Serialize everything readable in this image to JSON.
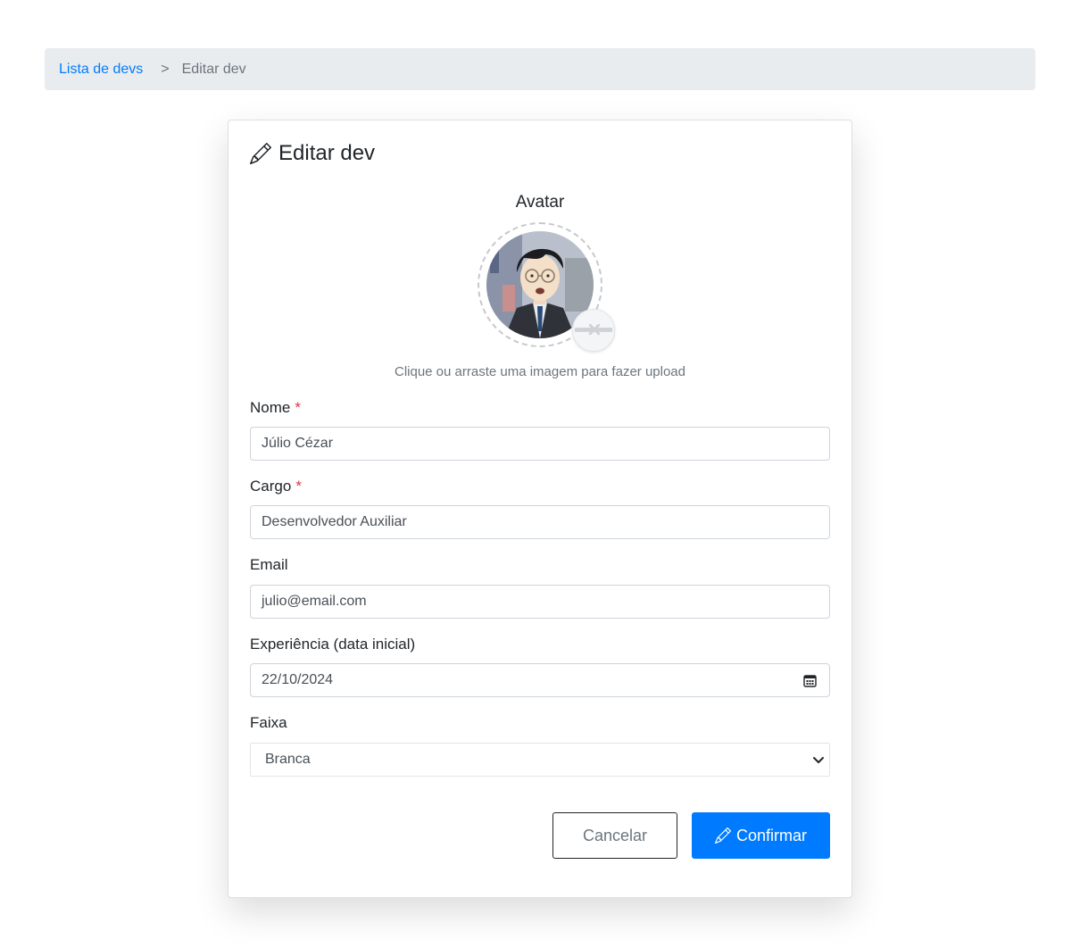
{
  "breadcrumb": {
    "parent": "Lista de devs",
    "separator": ">",
    "current": "Editar dev"
  },
  "card": {
    "title": "Editar dev",
    "title_icon": "pencil-icon"
  },
  "avatar": {
    "label": "Avatar",
    "hint": "Clique ou arraste uma imagem para fazer upload",
    "remove_icon": "remove-image-icon"
  },
  "form": {
    "name": {
      "label": "Nome",
      "required_mark": "*",
      "value": "Júlio Cézar"
    },
    "role": {
      "label": "Cargo",
      "required_mark": "*",
      "value": "Desenvolvedor Auxiliar"
    },
    "email": {
      "label": "Email",
      "value": "julio@email.com"
    },
    "experience": {
      "label": "Experiência (data inicial)",
      "value": "22/10/2024",
      "icon": "calendar-icon"
    },
    "belt": {
      "label": "Faixa",
      "selected": "Branca"
    }
  },
  "actions": {
    "cancel_label": "Cancelar",
    "confirm_label": "Confirmar"
  },
  "colors": {
    "primary": "#007bff",
    "required": "#dc3545",
    "muted": "#6c757d",
    "breadcrumb_bg": "#e9ecef"
  }
}
